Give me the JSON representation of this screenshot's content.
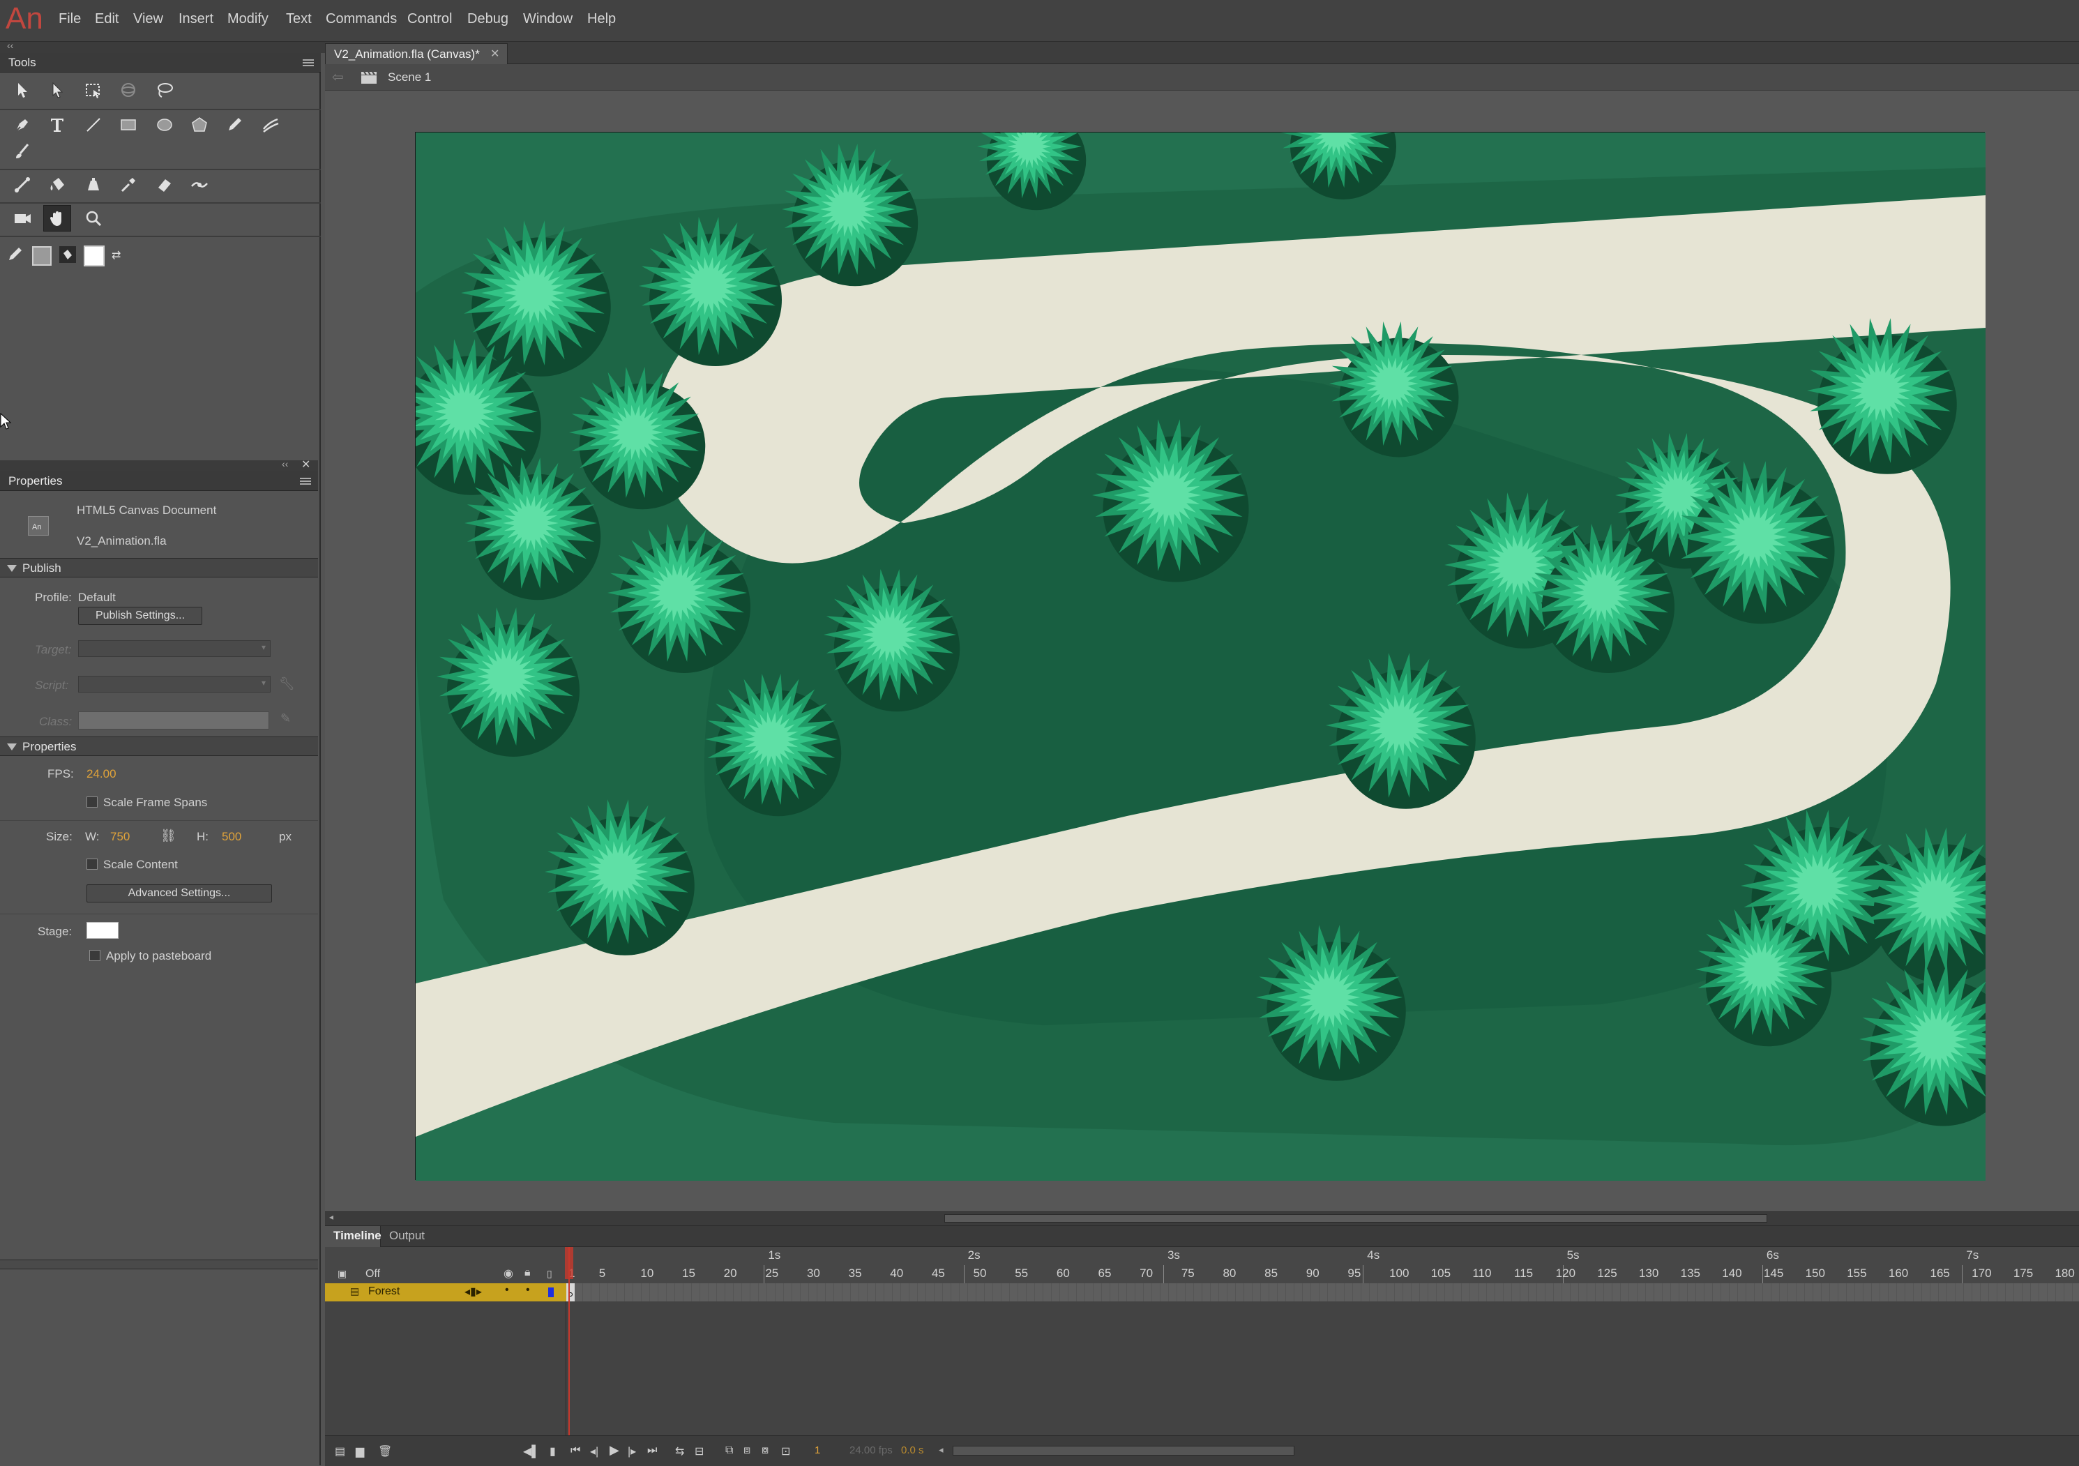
{
  "app": {
    "logo": "An"
  },
  "menu": [
    "File",
    "Edit",
    "View",
    "Insert",
    "Modify",
    "Text",
    "Commands",
    "Control",
    "Debug",
    "Window",
    "Help"
  ],
  "tools_panel": {
    "title": "Tools",
    "tools": [
      {
        "name": "selection-tool-icon"
      },
      {
        "name": "subselection-tool-icon"
      },
      {
        "name": "free-transform-tool-icon"
      },
      {
        "name": "3d-rotation-tool-icon"
      },
      {
        "name": "lasso-tool-icon"
      },
      {
        "name": "pen-tool-icon"
      },
      {
        "name": "text-tool-icon"
      },
      {
        "name": "line-tool-icon"
      },
      {
        "name": "rectangle-tool-icon"
      },
      {
        "name": "oval-tool-icon"
      },
      {
        "name": "polystar-tool-icon"
      },
      {
        "name": "pencil-tool-icon"
      },
      {
        "name": "paint-brush-tool-icon"
      },
      {
        "name": "brush-tool-icon"
      },
      {
        "name": "bone-tool-icon"
      },
      {
        "name": "paint-bucket-tool-icon"
      },
      {
        "name": "ink-bottle-tool-icon"
      },
      {
        "name": "eyedropper-tool-icon"
      },
      {
        "name": "eraser-tool-icon"
      },
      {
        "name": "width-tool-icon"
      },
      {
        "name": "camera-tool-icon"
      },
      {
        "name": "hand-tool-icon"
      },
      {
        "name": "zoom-tool-icon"
      }
    ],
    "stroke_color": "#9a9a9a",
    "fill_color": "#ffffff"
  },
  "properties_panel": {
    "title": "Properties",
    "doc_type": "HTML5 Canvas Document",
    "doc_name": "V2_Animation.fla",
    "publish": {
      "section": "Publish",
      "profile_label": "Profile:",
      "profile_value": "Default",
      "settings_button": "Publish Settings...",
      "target_label": "Target:",
      "script_label": "Script:",
      "class_label": "Class:"
    },
    "props": {
      "section": "Properties",
      "fps_label": "FPS:",
      "fps_value": "24.00",
      "scale_frame_spans": "Scale Frame Spans",
      "size_label": "Size:",
      "w_label": "W:",
      "w_value": "750",
      "h_label": "H:",
      "h_value": "500",
      "unit": "px",
      "scale_content": "Scale Content",
      "advanced_button": "Advanced Settings...",
      "stage_label": "Stage:",
      "stage_color": "#ffffff",
      "apply_pasteboard": "Apply to pasteboard"
    }
  },
  "document": {
    "tab_title": "V2_Animation.fla (Canvas)*",
    "scene": "Scene 1",
    "stage_colors": {
      "outer": "#237150",
      "inner": "#1d6646",
      "inner2": "#175d3f",
      "path": "#e6e4d4"
    }
  },
  "timeline": {
    "tabs": [
      "Timeline",
      "Output"
    ],
    "outline_layer": "Off",
    "layers": [
      {
        "name": "Forest"
      }
    ],
    "seconds": [
      "1s",
      "2s",
      "3s",
      "4s",
      "5s",
      "6s",
      "7s"
    ],
    "frame_numbers": [
      "1",
      "5",
      "10",
      "15",
      "20",
      "25",
      "30",
      "35",
      "40",
      "45",
      "50",
      "55",
      "60",
      "65",
      "70",
      "75",
      "80",
      "85",
      "90",
      "95",
      "100",
      "105",
      "110",
      "115",
      "120",
      "125",
      "130",
      "135",
      "140",
      "145",
      "150",
      "155",
      "160",
      "165",
      "170",
      "175",
      "180"
    ],
    "current_frame": "1",
    "fps_display": "24.00 fps",
    "time_display": "0.0 s"
  }
}
